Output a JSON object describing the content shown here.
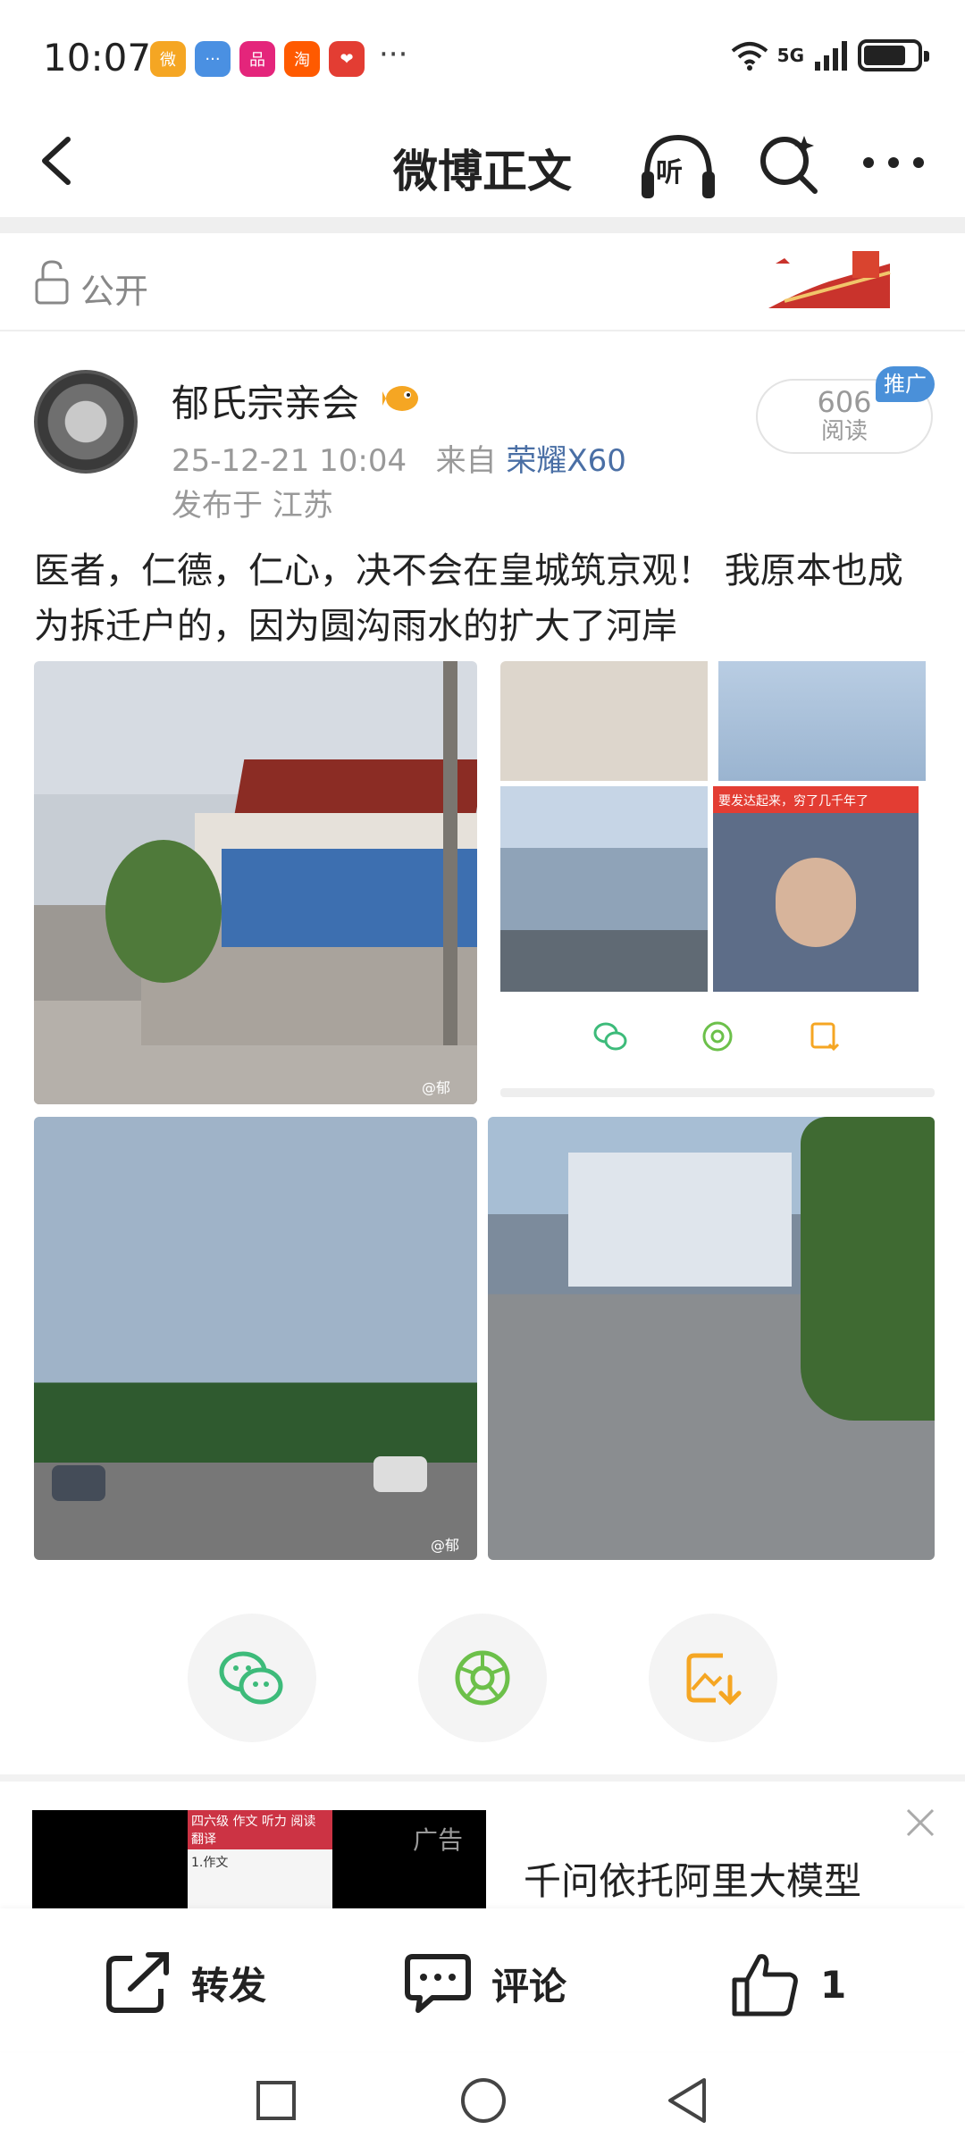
{
  "status_bar": {
    "time": "10:07",
    "apps": [
      {
        "name": "weibo-icon",
        "color": "#f5a623",
        "text": "微"
      },
      {
        "name": "message-icon",
        "color": "#4a90e2",
        "text": "···"
      },
      {
        "name": "vip-icon",
        "color": "#e4257b",
        "text": "品"
      },
      {
        "name": "taobao-icon",
        "color": "#ff5a00",
        "text": "淘"
      },
      {
        "name": "heart-app-icon",
        "color": "#e33d33",
        "text": "❤"
      }
    ],
    "more": "···",
    "network": "5G"
  },
  "navbar": {
    "title": "微博正文",
    "listen_label": "听"
  },
  "visibility": {
    "label": "公开"
  },
  "post": {
    "author": "郁氏宗亲会",
    "timestamp": "25-12-21 10:04",
    "source_prefix": "来自",
    "device": "荣耀X60",
    "location": "发布于 江苏",
    "views": "606",
    "views_label": "阅读",
    "promo_badge": "推广",
    "text": "医者，仁德，仁心，决不会在皇城筑京观！ 我原本也成为拆迁户的，因为圆沟雨水的扩大了河岸",
    "image_watermark": "@郁",
    "video_banner": "要发达起来，穷了几千年了"
  },
  "ad": {
    "tag": "广告",
    "title": "千问依托阿里大模型",
    "thumb_header": "四六级  作文  听力  阅读  翻译",
    "thumb_subheader": "1.作文"
  },
  "toolbar": {
    "forward": "转发",
    "comment": "评论",
    "like_count": "1"
  },
  "colors": {
    "accent_blue": "#4a6fa5",
    "share_green": "#3dbb7a",
    "save_orange": "#f5a623"
  }
}
